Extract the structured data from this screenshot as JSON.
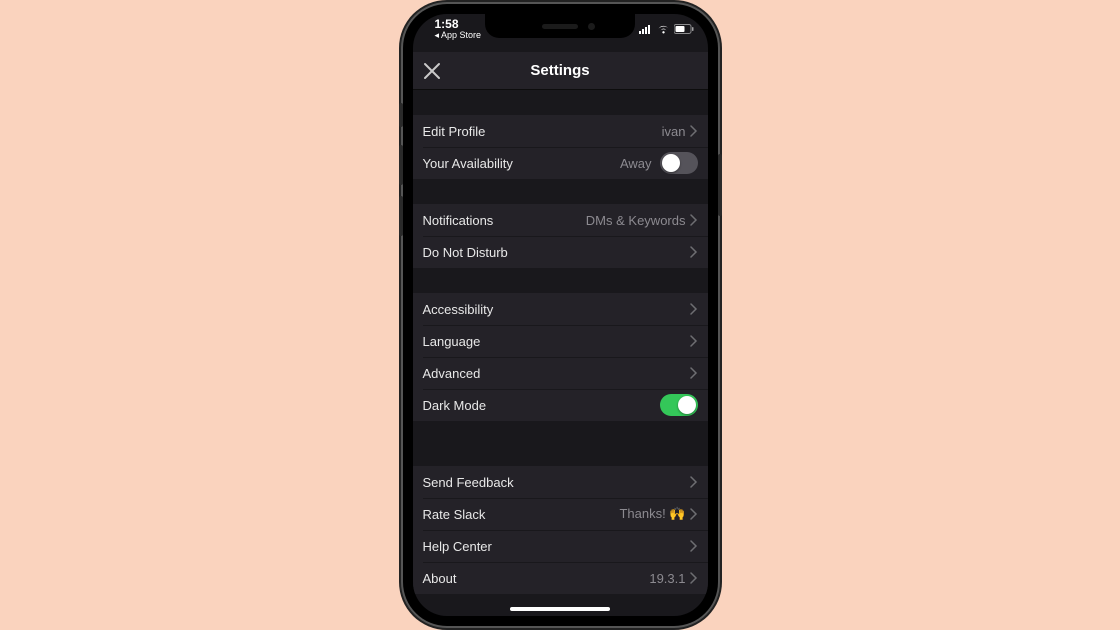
{
  "status": {
    "time": "1:58",
    "back": "App Store"
  },
  "nav": {
    "title": "Settings"
  },
  "rows": {
    "editProfile": {
      "label": "Edit Profile",
      "value": "ivan"
    },
    "availability": {
      "label": "Your Availability",
      "value": "Away"
    },
    "notifications": {
      "label": "Notifications",
      "value": "DMs & Keywords"
    },
    "dnd": {
      "label": "Do Not Disturb"
    },
    "accessibility": {
      "label": "Accessibility"
    },
    "language": {
      "label": "Language"
    },
    "advanced": {
      "label": "Advanced"
    },
    "darkMode": {
      "label": "Dark Mode"
    },
    "sendFeedback": {
      "label": "Send Feedback"
    },
    "rateSlack": {
      "label": "Rate Slack",
      "value": "Thanks! 🙌"
    },
    "helpCenter": {
      "label": "Help Center"
    },
    "about": {
      "label": "About",
      "value": "19.3.1"
    }
  },
  "toggles": {
    "availability": false,
    "darkMode": true
  }
}
